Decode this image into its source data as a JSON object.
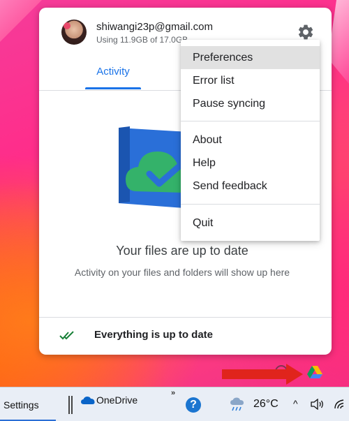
{
  "account": {
    "email": "shiwangi23p@gmail.com",
    "usage": "Using 11.9GB of 17.0GB"
  },
  "tabs": [
    {
      "label": "Activity",
      "selected": true
    }
  ],
  "activity": {
    "title": "Your files are up to date",
    "subtitle": "Activity on your files and folders will show up here"
  },
  "footer": {
    "status": "Everything is up to date"
  },
  "menu": {
    "items": [
      {
        "label": "Preferences",
        "highlighted": true
      },
      {
        "label": "Error list"
      },
      {
        "label": "Pause syncing"
      },
      {
        "label": "About"
      },
      {
        "label": "Help"
      },
      {
        "label": "Send feedback"
      },
      {
        "label": "Quit"
      }
    ]
  },
  "taskbar": {
    "settings_label": "Settings",
    "onedrive_label": "OneDrive",
    "overflow_label": "»",
    "help_label": "?",
    "temperature": "26°C",
    "tray_caret": "^"
  },
  "colors": {
    "accent": "#1a73e8",
    "menu_highlight": "#e1e1e1",
    "annotation_arrow": "#e0241c"
  },
  "icons": {
    "settings": "gear-icon",
    "drive_tray": "google-drive-icon",
    "sync_ok": "double-check-icon"
  }
}
